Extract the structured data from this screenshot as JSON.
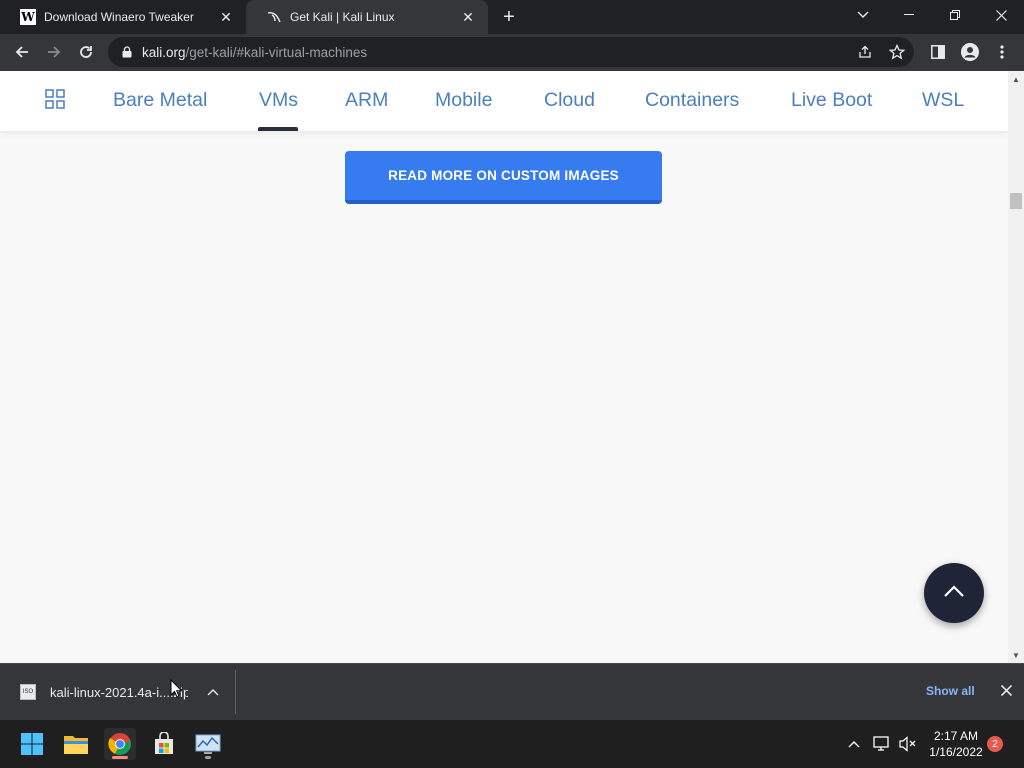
{
  "browser": {
    "tabs": [
      {
        "title": "Download Winaero Tweaker",
        "active": false,
        "favicon": "winaero-w-icon"
      },
      {
        "title": "Get Kali | Kali Linux",
        "active": true,
        "favicon": "kali-dragon-icon"
      }
    ],
    "url_host": "kali.org",
    "url_path": "/get-kali/#kali-virtual-machines"
  },
  "page": {
    "subnav": {
      "items": [
        {
          "label": "Bare Metal"
        },
        {
          "label": "VMs",
          "selected": true
        },
        {
          "label": "ARM"
        },
        {
          "label": "Mobile"
        },
        {
          "label": "Cloud"
        },
        {
          "label": "Containers"
        },
        {
          "label": "Live Boot"
        },
        {
          "label": "WSL"
        }
      ]
    },
    "cta_label": "READ MORE ON CUSTOM IMAGES",
    "colors": {
      "accent": "#367bf0",
      "nav_text": "#4a7fc0",
      "totop_bg": "#1f2537"
    }
  },
  "downloads": {
    "item_name": "kali-linux-2021.4a-i....zip",
    "show_all_label": "Show all"
  },
  "taskbar": {
    "apps": [
      "windows-start-icon",
      "file-explorer-icon",
      "chrome-icon",
      "microsoft-store-icon",
      "performance-monitor-icon"
    ],
    "time": "2:17 AM",
    "date": "1/16/2022",
    "notification_count": "2"
  }
}
